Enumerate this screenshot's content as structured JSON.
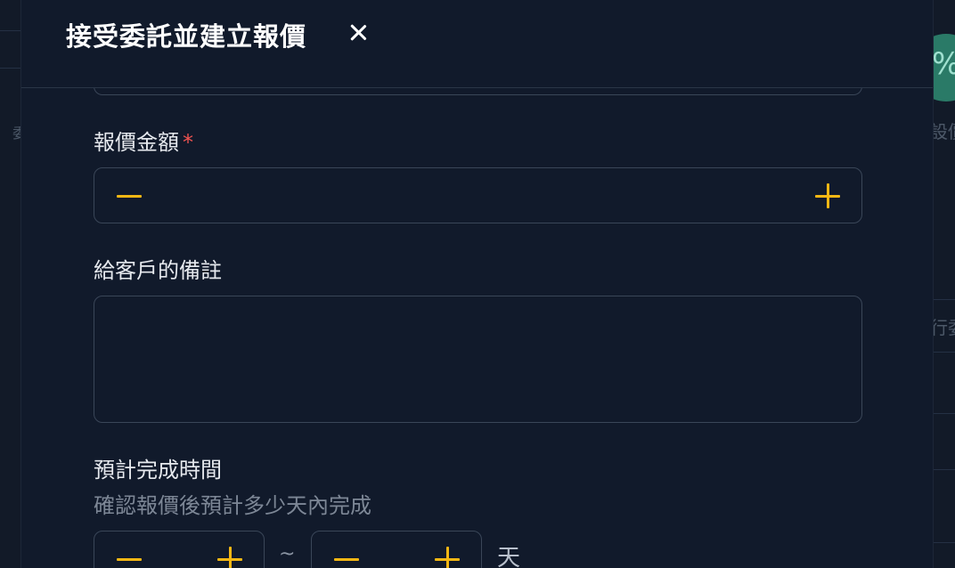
{
  "modal": {
    "title": "接受委託並建立報價"
  },
  "background": {
    "avatar_glyph": "%",
    "snippet_1": "設價",
    "snippet_2": "行委",
    "snippet_left": "委"
  },
  "form": {
    "price": {
      "label": "報價金額",
      "required_mark": "*",
      "value": ""
    },
    "note": {
      "label": "給客戶的備註",
      "value": ""
    },
    "estimate": {
      "label": "預計完成時間",
      "hint": "確認報價後預計多少天內完成",
      "min_value": "",
      "max_value": "",
      "separator": "~",
      "unit": "天"
    }
  },
  "colors": {
    "background": "#121a28",
    "modal_bg": "#111a2b",
    "border": "#3a4658",
    "accent": "#f5b714",
    "required": "#ef5350",
    "muted_text": "#7d8796"
  }
}
